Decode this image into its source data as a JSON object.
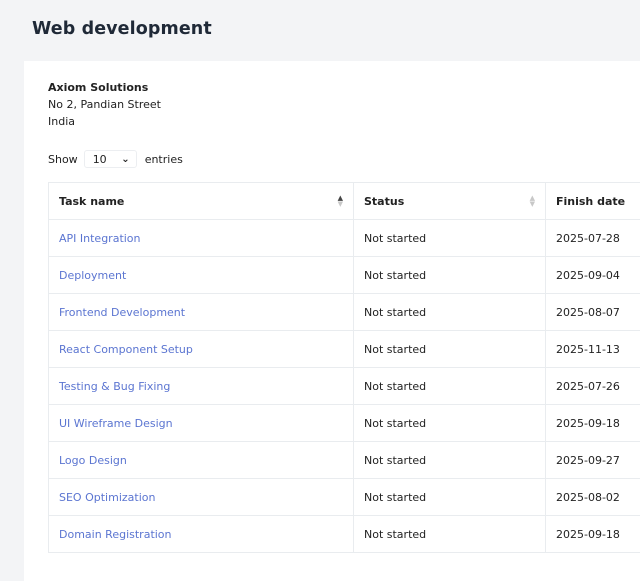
{
  "page": {
    "title": "Web development"
  },
  "company": {
    "name": "Axiom Solutions",
    "address": "No 2, Pandian Street",
    "country": "India"
  },
  "length": {
    "show_label": "Show",
    "selected": "10",
    "entries_label": "entries"
  },
  "table": {
    "columns": [
      "Task name",
      "Status",
      "Finish date"
    ],
    "sorted_column": "Task name",
    "sort_direction": "ascending",
    "rows": [
      {
        "task": "API Integration",
        "status": "Not started",
        "finish": "2025-07-28"
      },
      {
        "task": "Deployment",
        "status": "Not started",
        "finish": "2025-09-04"
      },
      {
        "task": "Frontend Development",
        "status": "Not started",
        "finish": "2025-08-07"
      },
      {
        "task": "React Component Setup",
        "status": "Not started",
        "finish": "2025-11-13"
      },
      {
        "task": "Testing & Bug Fixing",
        "status": "Not started",
        "finish": "2025-07-26"
      },
      {
        "task": "UI Wireframe Design",
        "status": "Not started",
        "finish": "2025-09-18"
      },
      {
        "task": "Logo Design",
        "status": "Not started",
        "finish": "2025-09-27"
      },
      {
        "task": "SEO Optimization",
        "status": "Not started",
        "finish": "2025-08-02"
      },
      {
        "task": "Domain Registration",
        "status": "Not started",
        "finish": "2025-09-18"
      }
    ]
  },
  "colors": {
    "link": "#5b75d1",
    "background": "#f3f4f6",
    "card": "#ffffff",
    "border": "#e9ecef"
  }
}
